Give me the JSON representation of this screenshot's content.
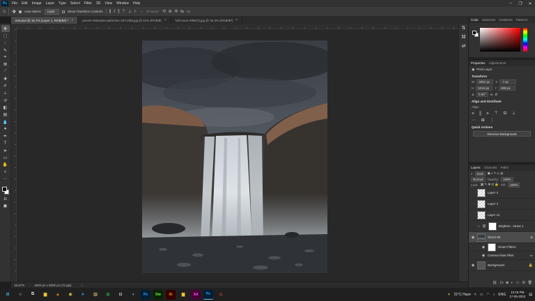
{
  "app": {
    "logo_text": "Ps",
    "menu": [
      "File",
      "Edit",
      "Image",
      "Layer",
      "Type",
      "Select",
      "Filter",
      "3D",
      "View",
      "Window",
      "Help"
    ],
    "window_controls": [
      "–",
      "❐",
      "✕"
    ]
  },
  "options_bar": {
    "auto_select_label": "Auto-Select:",
    "auto_select_value": "Layer",
    "transform_label": "Show Transform Controls",
    "mode_3d_label": "3D Mode:"
  },
  "tabs": [
    {
      "label": "test.psd @ 16.7% (Layer 1, RGB/8#) *",
      "active": true
    },
    {
      "label": "pexels-sebastian-palomino-1871488.jpg @ 21% (RGB/8)",
      "active": false
    },
    {
      "label": "full-moon-496873.jpg @ 33.3% (RGB/8#)",
      "active": false
    }
  ],
  "status": {
    "zoom": "16.67%",
    "doc_size": "4000 px x 5000 px (72 ppi)"
  },
  "color_panel": {
    "tabs": [
      "Color",
      "Swatches",
      "Gradients",
      "Patterns"
    ]
  },
  "properties": {
    "tabs": [
      "Properties",
      "Adjustments"
    ],
    "layer_type": "Pixel Layer",
    "transform_title": "Transform",
    "w_label": "W",
    "w_value": "4001 px",
    "h_label": "H",
    "h_value": "5216 px",
    "x_label": "X",
    "x_value": "-7 px",
    "y_label": "Y",
    "y_value": "838 px",
    "angle_value": "0.00°",
    "align_title": "Align and Distribute",
    "align_label": "Align:",
    "quick_actions_title": "Quick Actions",
    "remove_bg_label": "Remove Background"
  },
  "layers_panel": {
    "tabs": [
      "Layers",
      "Channels",
      "Paths"
    ],
    "kind_label": "Kind",
    "blend_mode": "Normal",
    "opacity_label": "Opacity:",
    "opacity_value": "100%",
    "lock_label": "Lock:",
    "fill_label": "Fill:",
    "fill_value": "100%",
    "layers": [
      {
        "name": "Layer 3",
        "thumb": "trans",
        "visible": false,
        "type": "normal"
      },
      {
        "name": "Layer 4",
        "thumb": "trans",
        "visible": false,
        "type": "normal"
      },
      {
        "name": "Layer 12",
        "thumb": "trans",
        "visible": false,
        "type": "normal"
      },
      {
        "name": "Brightne...ntrast 1",
        "thumb": "white",
        "visible": false,
        "type": "adjust"
      },
      {
        "name": "Storm 89",
        "thumb": "photo",
        "visible": true,
        "type": "smart"
      },
      {
        "name": "Smart Filters",
        "thumb": "white",
        "visible": true,
        "type": "sub"
      },
      {
        "name": "Camera Raw Filter",
        "thumb": "none",
        "visible": true,
        "type": "sub2"
      },
      {
        "name": "Background",
        "thumb": "dark",
        "visible": true,
        "type": "bg"
      }
    ]
  },
  "taskbar": {
    "apps": [
      "Ps",
      "Dw",
      "Ai",
      "Xd",
      "Ps"
    ],
    "weather": "21°C Haze",
    "lang": "ENG",
    "time": "12:19 PM",
    "date": "17-05-2022"
  }
}
